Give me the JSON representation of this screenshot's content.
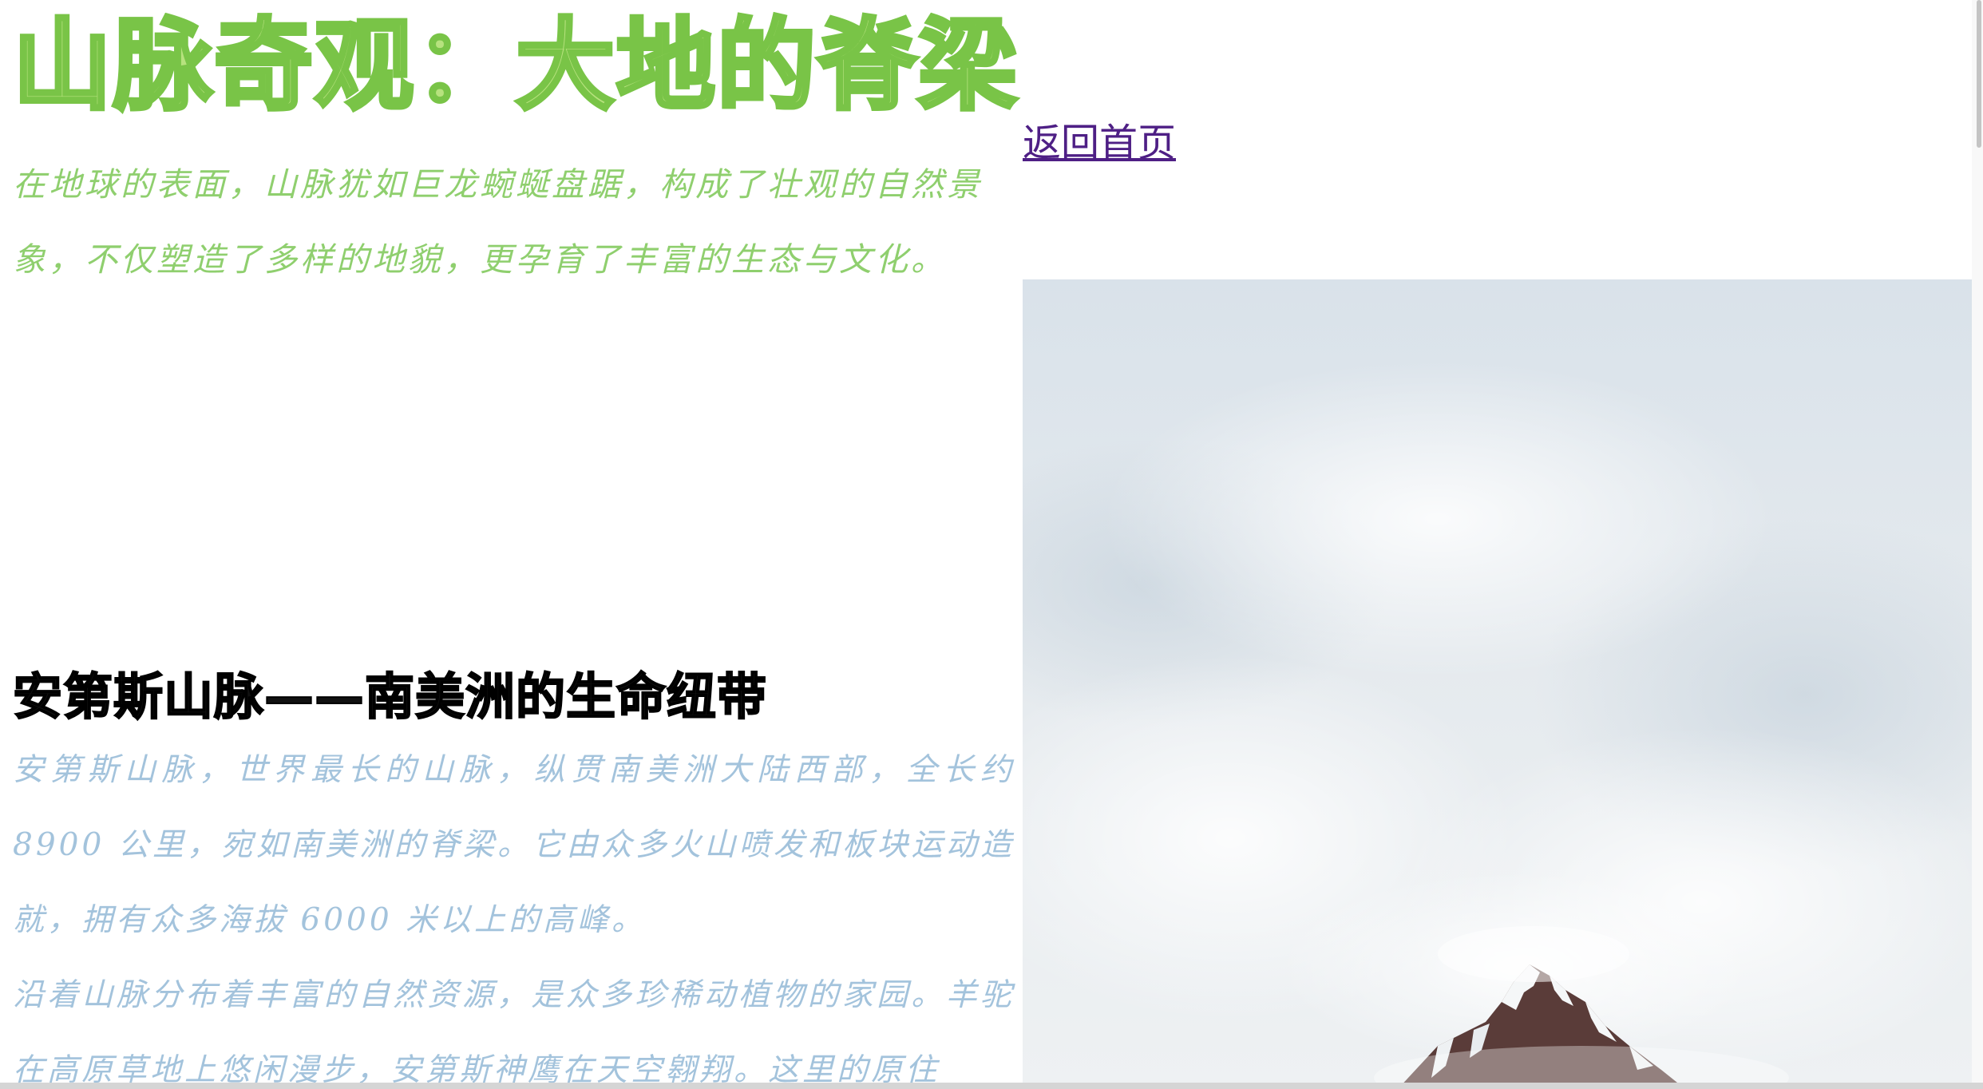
{
  "page": {
    "title": "山脉奇观：大地的脊梁",
    "intro": "在地球的表面，山脉犹如巨龙蜿蜒盘踞，构成了壮观的自然景象，不仅塑造了多样的地貌，更孕育了丰富的生态与文化。"
  },
  "nav": {
    "back_home_label": "返回首页"
  },
  "section": {
    "heading": "安第斯山脉——南美洲的生命纽带",
    "paragraphs": [
      "安第斯山脉，世界最长的山脉，纵贯南美洲大陆西部，全长约 8900 公里，宛如南美洲的脊梁。它由众多火山喷发和板块运动造就，拥有众多海拔 6000 米以上的高峰。",
      "沿着山脉分布着丰富的自然资源，是众多珍稀动植物的家园。羊驼在高原草地上悠闲漫步，安第斯神鹰在天空翱翔。这里的原住"
    ]
  },
  "hero_image": {
    "alt": "雾中山峰",
    "colors": {
      "sky": "#e3e9ee",
      "mist": "#f2f4f6",
      "rock": "#5a3c39",
      "snow": "#f5f7f8"
    }
  },
  "colors": {
    "title_fill": "#b7e27e",
    "title_stroke": "#79c447",
    "intro_text": "#8fcf6e",
    "body_text": "#a3c3dc",
    "link": "#4e1f85"
  }
}
